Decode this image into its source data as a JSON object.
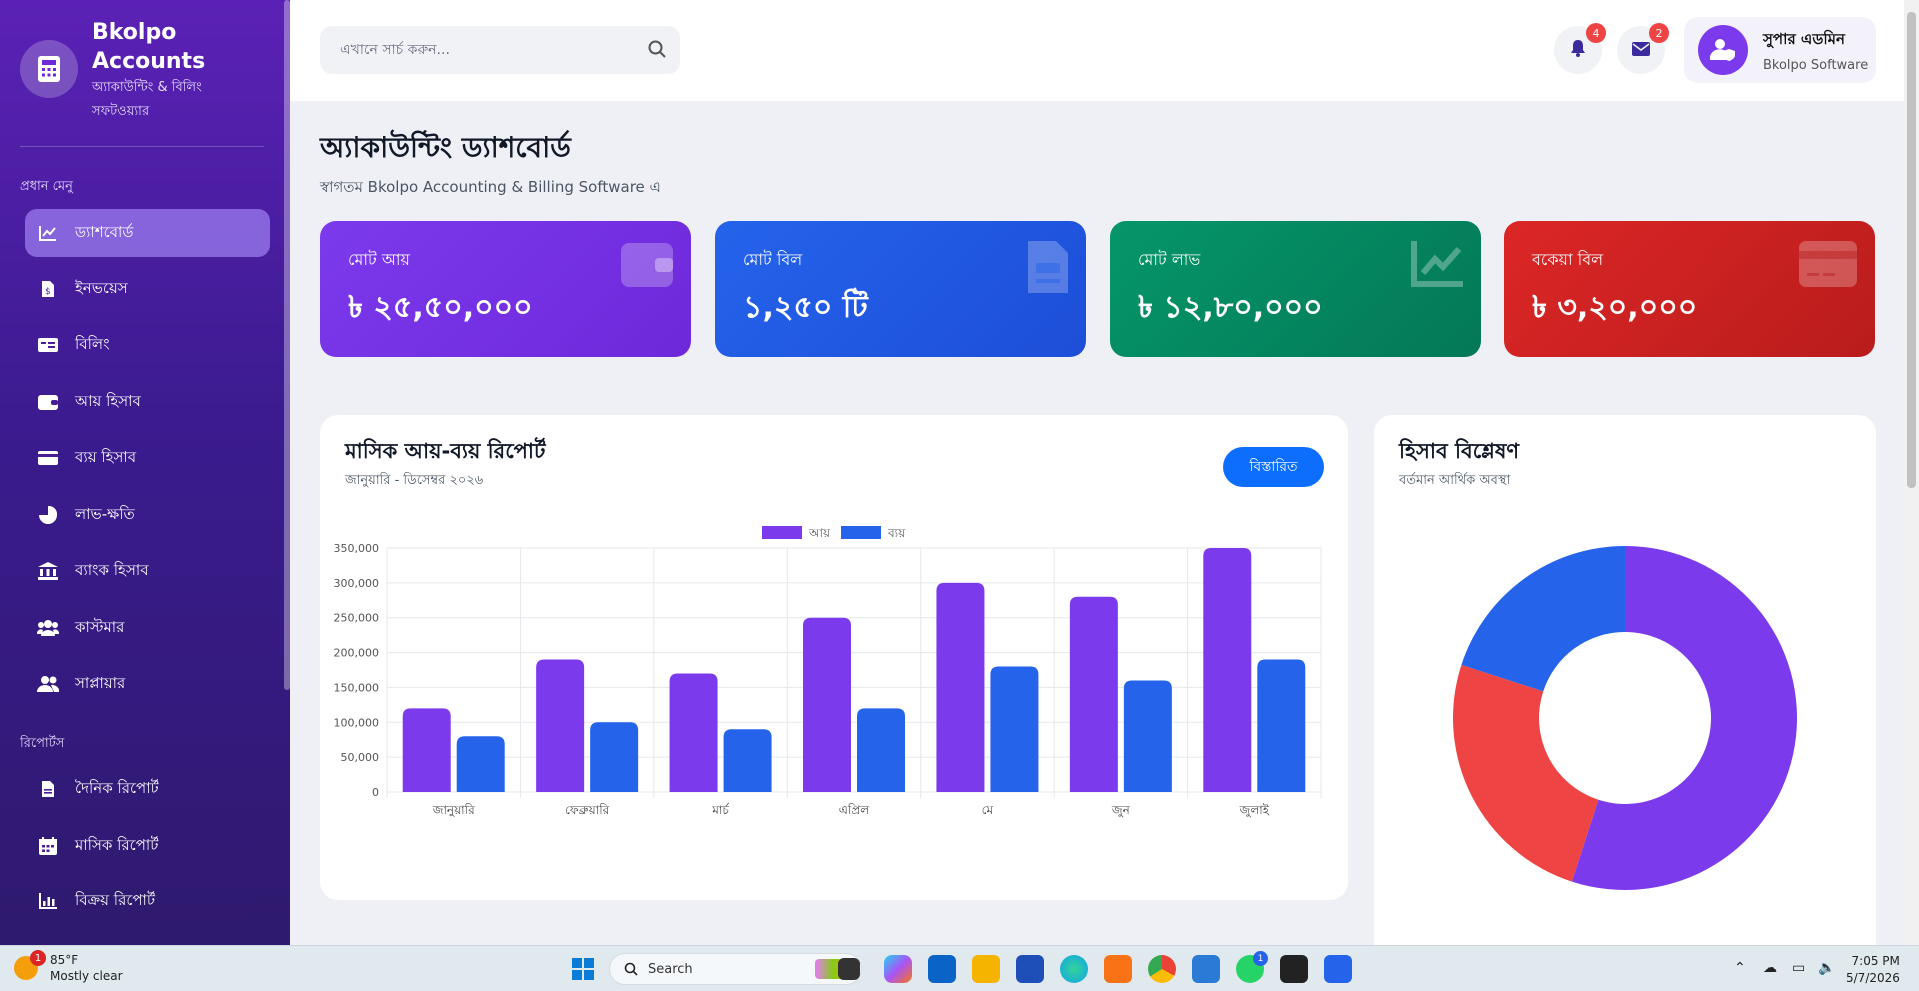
{
  "brand": {
    "name": "Bkolpo Accounts",
    "subtitle": "অ্যাকাউন্টিং & বিলিং সফটওয়্যার"
  },
  "sidebar": {
    "sections": [
      {
        "title": "প্রধান মেনু"
      },
      {
        "title": "রিপোর্টস"
      }
    ],
    "items": [
      {
        "label": "ড্যাশবোর্ড",
        "icon": "chart-line-icon",
        "active": true
      },
      {
        "label": "ইনভয়েস",
        "icon": "invoice-icon"
      },
      {
        "label": "বিলিং",
        "icon": "billing-icon"
      },
      {
        "label": "আয় হিসাব",
        "icon": "wallet-icon"
      },
      {
        "label": "ব্যয় হিসাব",
        "icon": "credit-card-icon"
      },
      {
        "label": "লাভ-ক্ষতি",
        "icon": "pie-chart-icon"
      },
      {
        "label": "ব্যাংক হিসাব",
        "icon": "bank-icon"
      },
      {
        "label": "কাস্টমার",
        "icon": "users-icon"
      },
      {
        "label": "সাপ্লায়ার",
        "icon": "user-group-icon"
      },
      {
        "label": "দৈনিক রিপোর্ট",
        "icon": "file-icon"
      },
      {
        "label": "মাসিক রিপোর্ট",
        "icon": "calendar-icon"
      },
      {
        "label": "বিক্রয় রিপোর্ট",
        "icon": "bar-chart-icon"
      }
    ]
  },
  "topbar": {
    "search_placeholder": "এখানে সার্চ করুন...",
    "notifications_count": "4",
    "messages_count": "2",
    "user_name": "সুপার এডমিন",
    "user_org": "Bkolpo Software"
  },
  "page": {
    "title": "অ্যাকাউন্টিং ড্যাশবোর্ড",
    "subtitle": "স্বাগতম Bkolpo Accounting & Billing Software এ"
  },
  "cards": [
    {
      "label": "মোট আয়",
      "value": "৳ ২৫,৫০,০০০",
      "icon": "wallet-icon",
      "color": "#7c3aed"
    },
    {
      "label": "মোট বিল",
      "value": "১,২৫০ টি",
      "icon": "invoice-icon",
      "color": "#2563eb"
    },
    {
      "label": "মোট লাভ",
      "value": "৳ ১২,৮০,০০০",
      "icon": "chart-line-icon",
      "color": "#059669"
    },
    {
      "label": "বকেয়া বিল",
      "value": "৳ ৩,২০,০০০",
      "icon": "credit-card-icon",
      "color": "#dc2626"
    }
  ],
  "report_panel": {
    "title": "মাসিক আয়-ব্যয় রিপোর্ট",
    "subtitle": "জানুয়ারি - ডিসেম্বর ২০২৬",
    "button": "বিস্তারিত"
  },
  "analysis_panel": {
    "title": "হিসাব বিশ্লেষণ",
    "subtitle": "বর্তমান আর্থিক অবস্থা"
  },
  "chart_data": [
    {
      "type": "bar",
      "categories": [
        "জানুয়ারি",
        "ফেব্রুয়ারি",
        "মার্চ",
        "এপ্রিল",
        "মে",
        "জুন",
        "জুলাই"
      ],
      "series": [
        {
          "name": "আয়",
          "color": "#7c3aed",
          "values": [
            120000,
            190000,
            170000,
            250000,
            300000,
            280000,
            350000
          ]
        },
        {
          "name": "ব্যয়",
          "color": "#2563eb",
          "values": [
            80000,
            100000,
            90000,
            120000,
            180000,
            160000,
            190000
          ]
        }
      ],
      "ylim": [
        0,
        350000
      ],
      "yticks": [
        "0",
        "50,000",
        "100,000",
        "150,000",
        "200,000",
        "250,000",
        "300,000",
        "350,000"
      ],
      "legend": "top-center",
      "grid": true
    },
    {
      "type": "pie",
      "donut": true,
      "slices": [
        {
          "value": 55,
          "color": "#7c3aed"
        },
        {
          "value": 25,
          "color": "#ef4444"
        },
        {
          "value": 20,
          "color": "#2563eb"
        }
      ]
    }
  ],
  "taskbar": {
    "temperature": "85°F",
    "weather": "Mostly clear",
    "weather_badge": "1",
    "search_label": "Search",
    "whatsapp_badge": "1",
    "time": "7:05 PM",
    "date": "5/7/2026"
  }
}
